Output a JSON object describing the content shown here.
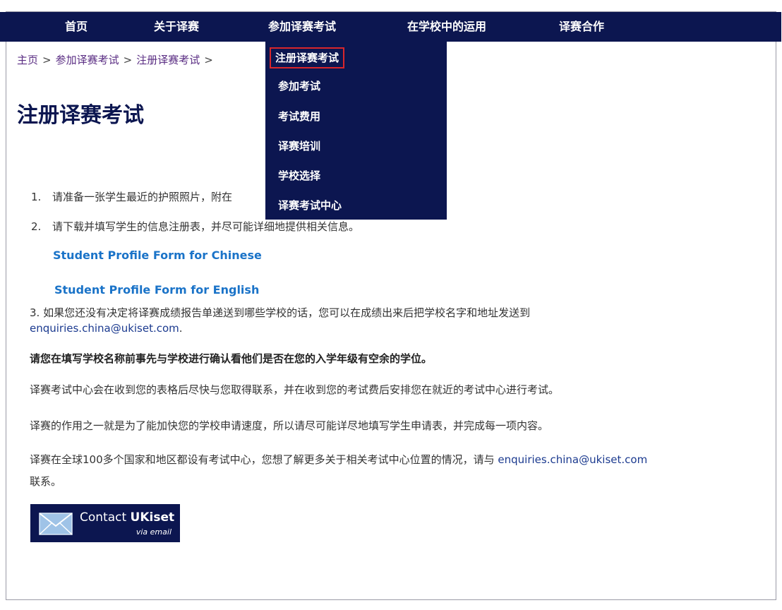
{
  "nav": {
    "items": [
      "首页",
      "关于译赛",
      "参加译赛考试",
      "在学校中的运用",
      "译赛合作"
    ]
  },
  "dropdown": {
    "items": [
      "注册译赛考试",
      "参加考试",
      "考试费用",
      "译赛培训",
      "学校选择",
      "译赛考试中心"
    ]
  },
  "breadcrumb": {
    "items": [
      "主页",
      "参加译赛考试",
      "注册译赛考试"
    ],
    "separator": ">"
  },
  "page_title": "注册译赛考试",
  "steps": [
    {
      "num": "1.",
      "text": "请准备一张学生最近的护照照片，附在"
    },
    {
      "num": "2.",
      "text": "请下载并填写学生的信息注册表，并尽可能详细地提供相关信息。"
    }
  ],
  "links": {
    "form_chinese": "Student Profile Form for Chinese",
    "form_english": "Student Profile Form for English"
  },
  "step3": {
    "text": "3.  如果您还没有决定将译赛成绩报告单递送到哪些学校的话，您可以在成绩出来后把学校名字和地址发送到",
    "email": "enquiries.china@ukiset.com",
    "suffix": "."
  },
  "paragraphs": {
    "bold_note": "请您在填写学校名称前事先与学校进行确认看他们是否在您的入学年级有空余的学位。",
    "p1": "译赛考试中心会在收到您的表格后尽快与您取得联系，并在收到您的考试费后安排您在就近的考试中心进行考试。",
    "p2": "译赛的作用之一就是为了能加快您的学校申请速度，所以请尽可能详尽地填写学生申请表，并完成每一项内容。",
    "p3_prefix": "译赛在全球100多个国家和地区都设有考试中心，您想了解更多关于相关考试中心位置的情况，请与 ",
    "p3_email": "enquiries.china@ukiset.com",
    "p3_suffix": "联系。"
  },
  "contact_button": {
    "label_prefix": "Contact ",
    "label_brand": "UKiset",
    "sub": "via email"
  },
  "colors": {
    "nav_bg": "#0c1650",
    "accent_red": "#d8262b",
    "link_blue": "#1a73c8",
    "breadcrumb_purple": "#5a2d83"
  },
  "icons": {
    "contact": "envelope-icon"
  }
}
